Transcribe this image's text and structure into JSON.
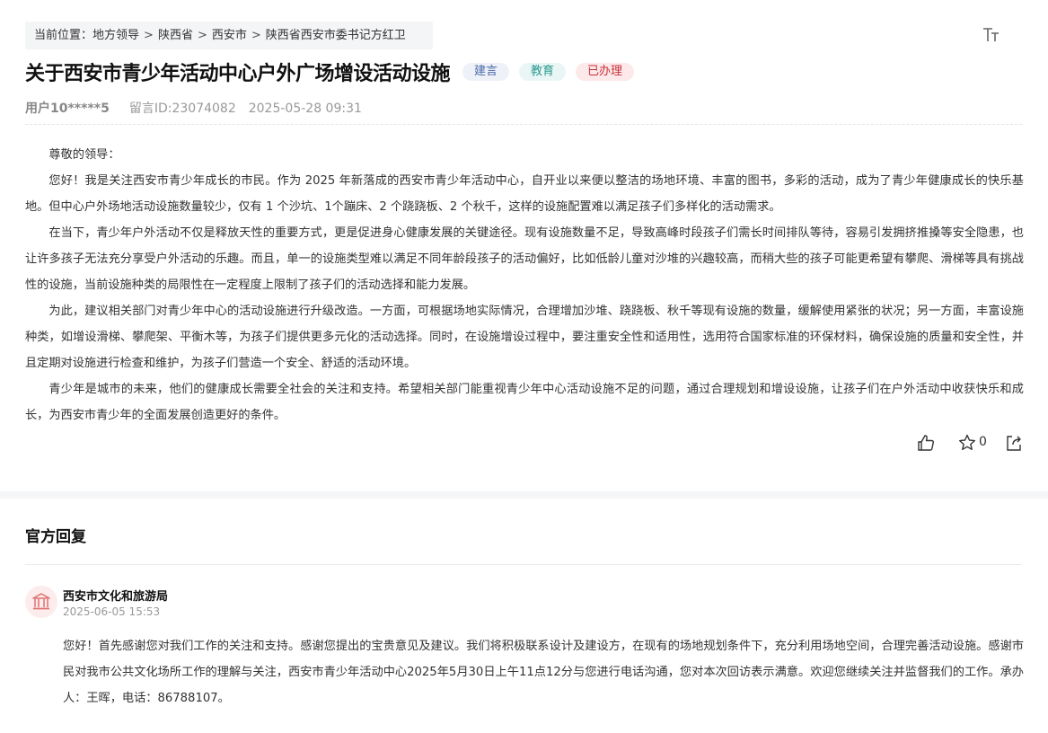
{
  "breadcrumb": {
    "prefix": "当前位置：",
    "items": [
      "地方领导",
      "陕西省",
      "西安市",
      "陕西省西安市委书记方红卫"
    ],
    "separator": ">"
  },
  "toolbar": {
    "font_size_icon": "text-size-icon"
  },
  "post": {
    "title": "关于西安市青少年活动中心户外广场增设活动设施",
    "tags": [
      "建言",
      "教育",
      "已办理"
    ],
    "user": "用户10*****5",
    "message_id": "留言ID:23074082",
    "datetime": "2025-05-28 09:31",
    "paragraphs": [
      "尊敬的领导：",
      "您好！我是关注西安市青少年成长的市民。作为 2025 年新落成的西安市青少年活动中心，自开业以来便以整洁的场地环境、丰富的图书，多彩的活动，成为了青少年健康成长的快乐基地。但中心户外场地活动设施数量较少，仅有 1 个沙坑、1个蹦床、2 个跷跷板、2 个秋千，这样的设施配置难以满足孩子们多样化的活动需求。",
      "在当下，青少年户外活动不仅是释放天性的重要方式，更是促进身心健康发展的关键途径。现有设施数量不足，导致高峰时段孩子们需长时间排队等待，容易引发拥挤推搡等安全隐患，也让许多孩子无法充分享受户外活动的乐趣。而且，单一的设施类型难以满足不同年龄段孩子的活动偏好，比如低龄儿童对沙堆的兴趣较高，而稍大些的孩子可能更希望有攀爬、滑梯等具有挑战性的设施，当前设施种类的局限性在一定程度上限制了孩子们的活动选择和能力发展。",
      "为此，建议相关部门对青少年中心的活动设施进行升级改造。一方面，可根据场地实际情况，合理增加沙堆、跷跷板、秋千等现有设施的数量，缓解使用紧张的状况；另一方面，丰富设施种类，如增设滑梯、攀爬架、平衡木等，为孩子们提供更多元化的活动选择。同时，在设施增设过程中，要注重安全性和适用性，选用符合国家标准的环保材料，确保设施的质量和安全性，并且定期对设施进行检查和维护，为孩子们营造一个安全、舒适的活动环境。",
      "青少年是城市的未来，他们的健康成长需要全社会的关注和支持。希望相关部门能重视青少年中心活动设施不足的问题，通过合理规划和增设设施，让孩子们在户外活动中收获快乐和成长，为西安市青少年的全面发展创造更好的条件。"
    ],
    "actions": {
      "like_icon": "thumbs-up-icon",
      "star_icon": "star-icon",
      "star_count": "0",
      "share_icon": "share-icon"
    }
  },
  "reply": {
    "header": "官方回复",
    "org_name": "西安市文化和旅游局",
    "org_icon": "government-building-icon",
    "datetime": "2025-06-05 15:53",
    "text": "您好！首先感谢您对我们工作的关注和支持。感谢您提出的宝贵意见及建议。我们将积极联系设计及建设方，在现有的场地规划条件下，充分利用场地空间，合理完善活动设施。感谢市民对我市公共文化场所工作的理解与关注，西安市青少年活动中心2025年5月30日上午11点12分与您进行电话沟通，您对本次回访表示满意。欢迎您继续关注并监督我们的工作。承办人：王晖，电话：86788107。"
  },
  "colors": {
    "tag_blue_text": "#4a6aa8",
    "tag_green_text": "#2a9a8f",
    "tag_red_text": "#c8323a",
    "org_icon": "#e07070"
  }
}
